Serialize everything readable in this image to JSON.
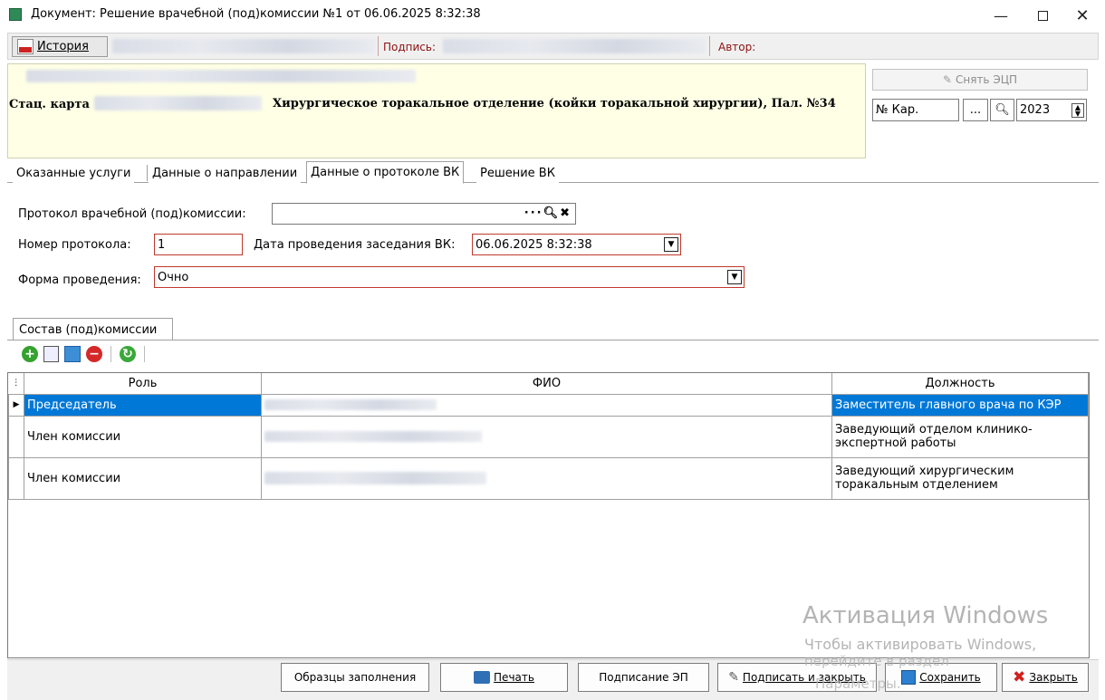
{
  "window": {
    "title": "Документ: Решение врачебной (под)комиссии №1 от 06.06.2025 8:32:38"
  },
  "toolbar": {
    "history_label": "История",
    "signature_label": "Подпись:",
    "author_label": "Автор:"
  },
  "info": {
    "card_label": "Стац. карта",
    "department": "Хирургическое торакальное отделение (койки торакальной хирургии), Пал. №34"
  },
  "right": {
    "remove_ecp_label": "Снять ЭЦП",
    "card_no_value": "№ Кар.",
    "dots": "...",
    "year_value": "2023"
  },
  "tabs": [
    "Оказанные услуги",
    "Данные о направлении",
    "Данные о протоколе ВК",
    "Решение ВК"
  ],
  "form": {
    "protocol_label": "Протокол врачебной (под)комиссии:",
    "protocol_value": "",
    "number_label": "Номер протокола:",
    "number_value": "1",
    "date_label": "Дата проведения заседания ВК:",
    "date_value": "06.06.2025 8:32:38",
    "form_label": "Форма проведения:",
    "form_value": "Очно"
  },
  "subtab": "Состав (под)комиссии",
  "grid": {
    "columns": [
      "Роль",
      "ФИО",
      "Должность"
    ],
    "rows": [
      {
        "role": "Председатель",
        "position": "Заместитель главного врача по КЭР"
      },
      {
        "role": "Член комиссии",
        "position": "Заведующий отделом клинико-экспертной работы"
      },
      {
        "role": "Член комиссии",
        "position": "Заведующий хирургическим торакальным отделением"
      }
    ]
  },
  "buttons": {
    "samples": "Образцы заполнения",
    "print": "Печать",
    "sign_ep": "Подписание ЭП",
    "sign_close": "Подписать и закрыть",
    "save": "Сохранить",
    "close": "Закрыть"
  },
  "watermark": {
    "line1": "Активация Windows",
    "line2": "Чтобы активировать Windows,",
    "line3": "перейдите в раздел",
    "line4": "Параметры."
  },
  "colors": {
    "selection": "#0078d7",
    "info_bg": "#ffffe6",
    "required_border": "#c0392b"
  }
}
